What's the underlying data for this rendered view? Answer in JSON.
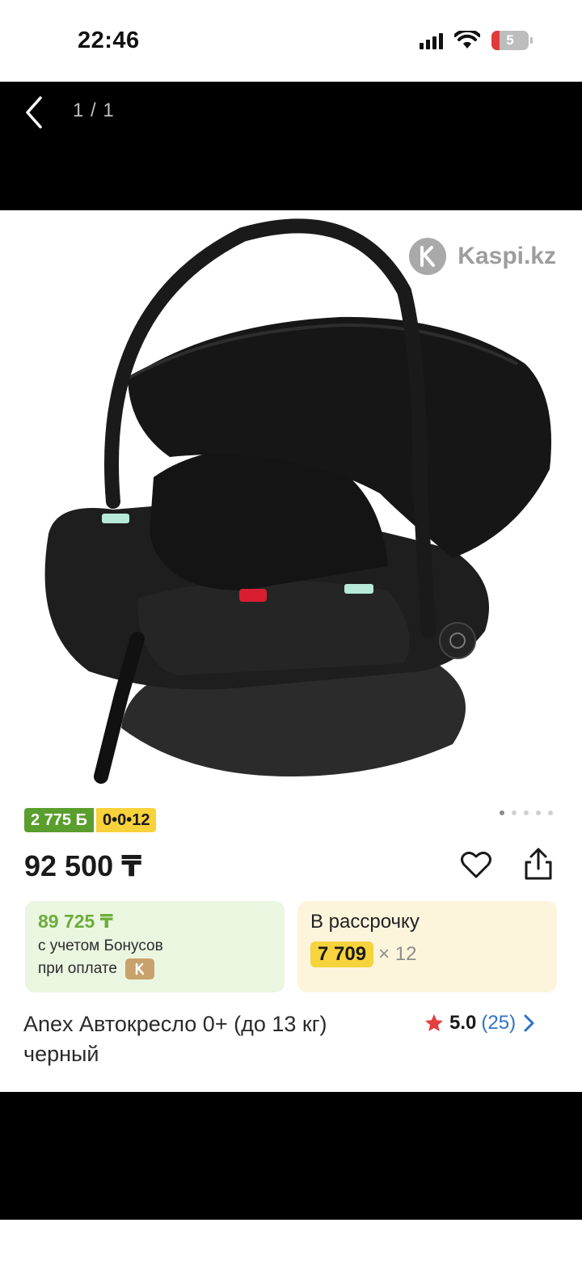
{
  "status_bar": {
    "time": "22:46",
    "battery_level": "5",
    "icons": [
      "signal-icon",
      "wifi-icon",
      "battery-icon"
    ]
  },
  "viewer": {
    "counter": "1 / 1"
  },
  "watermark": {
    "text": "Kaspi.kz"
  },
  "product": {
    "badges": {
      "bonus": "2 775 Б",
      "installment": "0•0•12"
    },
    "price": "92 500 ₸",
    "bonus_offer": {
      "price": "89 725 ₸",
      "line1": "с учетом Бонусов",
      "line2": "при оплате"
    },
    "credit": {
      "title": "В рассрочку",
      "monthly": "7 709",
      "months": "× 12"
    },
    "title": "Anex Автокресло 0+ (до 13 кг) черный",
    "rating": {
      "score": "5.0",
      "count": "(25)"
    },
    "gallery": {
      "total": 5,
      "active": 1
    }
  },
  "colors": {
    "bonus_green": "#5a9e2e",
    "installment_yellow": "#f7d23a",
    "star_red": "#e53e3e",
    "link_blue": "#2e72c8"
  }
}
